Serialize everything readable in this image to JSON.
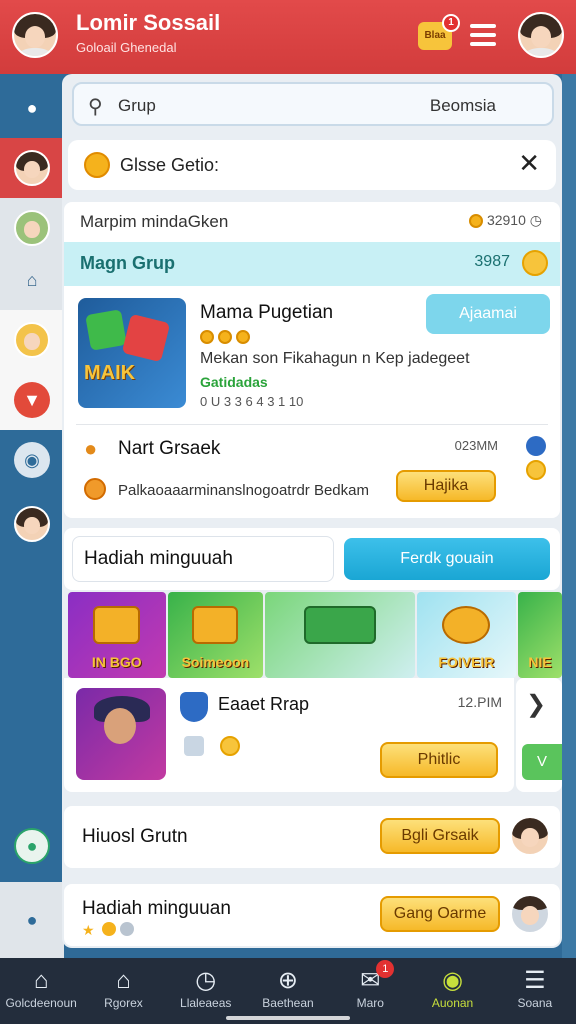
{
  "header": {
    "title": "Lomir Sossail",
    "subtitle": "Goloail Ghenedal",
    "chat_badge_label": "Blaa",
    "chat_badge_count": "1"
  },
  "search": {
    "placeholder": "Grup",
    "right_label": "Beomsia"
  },
  "filter": {
    "label": "Glsse Getio:"
  },
  "section_header": {
    "label": "Marpim mindaGken",
    "value": "32910"
  },
  "group_bar": {
    "title": "Magn Grup",
    "value": "3987"
  },
  "game_item": {
    "art_label": "MAIK",
    "art_label2": "MAIK",
    "title": "Mama Pugetian",
    "description": "Mekan son Fikahagun n Kep jadegeet",
    "status": "Gatidadas",
    "time": "0 U 3 3 6 4 3 1 10",
    "button": "Ajaamai"
  },
  "notification": {
    "title": "Nart Grsaek",
    "time": "023MM",
    "description": "Palkaoaaarminanslnogoatrdr Bedkam",
    "button": "Hajika"
  },
  "reward": {
    "label": "Hadiah minguuah",
    "button": "Ferdk gouain"
  },
  "banner_tiles": [
    "IN BGO",
    "Soimeoon",
    "",
    "FOIVEIR",
    "NIE"
  ],
  "match_item": {
    "title": "Eaaet Rrap",
    "time": "12.PIM",
    "button": "Phitlic",
    "side_button": "V"
  },
  "row1": {
    "label": "Hiuosl Grutn",
    "button": "Bgli Grsaik"
  },
  "row2": {
    "label": "Hadiah minguuan",
    "button": "Gang Oarme"
  },
  "bottom_nav": [
    {
      "label": "Golcdeenoun",
      "icon": "home-icon"
    },
    {
      "label": "Rgorex",
      "icon": "house-icon"
    },
    {
      "label": "Llaleaeas",
      "icon": "clock-icon"
    },
    {
      "label": "Baethean",
      "icon": "plus-circle-icon"
    },
    {
      "label": "Maro",
      "icon": "mail-icon",
      "badge": "1"
    },
    {
      "label": "Auonan",
      "icon": "profile-icon",
      "active": true
    },
    {
      "label": "Soana",
      "icon": "menu-icon"
    }
  ],
  "colors": {
    "header_red": "#d84545",
    "rail_blue": "#2e6b99",
    "teal_bar": "#c8f0f5",
    "gold_button": "#f6b929",
    "blue_button": "#1aa6d4",
    "nav_bg": "#232d3c",
    "nav_active": "#c7df3c"
  }
}
